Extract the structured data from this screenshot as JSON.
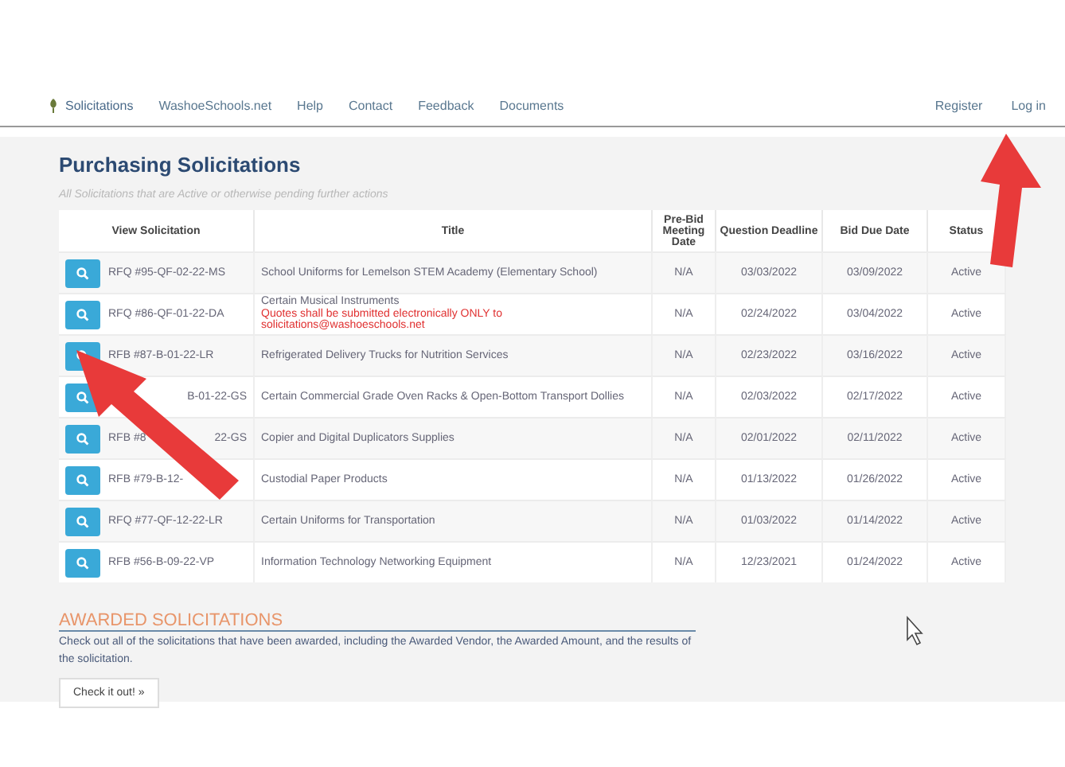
{
  "nav": {
    "items": [
      {
        "label": "Solicitations",
        "selected": true
      },
      {
        "label": "WashoeSchools.net",
        "selected": false
      },
      {
        "label": "Help",
        "selected": false
      },
      {
        "label": "Contact",
        "selected": false
      },
      {
        "label": "Feedback",
        "selected": false
      },
      {
        "label": "Documents",
        "selected": false
      }
    ],
    "right": [
      "Register",
      "Log in"
    ]
  },
  "heading": "Purchasing Solicitations",
  "subheading": "All Solicitations that are Active or otherwise pending further actions",
  "table": {
    "columns": [
      "View Solicitation",
      "Title",
      "Pre-Bid Meeting Date",
      "Question Deadline",
      "Bid Due Date",
      "Status"
    ],
    "rows": [
      {
        "solicitation": "RFQ #95-QF-02-22-MS",
        "title": "School Uniforms for Lemelson STEM Academy (Elementary School)",
        "prebid": "N/A",
        "question": "03/03/2022",
        "due": "03/09/2022",
        "status": "Active"
      },
      {
        "solicitation": "RFQ #86-QF-01-22-DA",
        "title": "Certain Musical Instruments",
        "note": "Quotes shall be submitted electronically ONLY to solicitations@washoeschools.net",
        "prebid": "N/A",
        "question": "02/24/2022",
        "due": "03/04/2022",
        "status": "Active"
      },
      {
        "solicitation": "RFB #87-B-01-22-LR",
        "title": "Refrigerated Delivery Trucks for Nutrition Services",
        "prebid": "N/A",
        "question": "02/23/2022",
        "due": "03/16/2022",
        "status": "Active"
      },
      {
        "solicitation_end": "B-01-22-GS",
        "title": "Certain Commercial Grade Oven Racks & Open-Bottom Transport Dollies",
        "prebid": "N/A",
        "question": "02/03/2022",
        "due": "02/17/2022",
        "status": "Active"
      },
      {
        "solicitation": "RFB #8",
        "solicitation_end": "22-GS",
        "title": "Copier and Digital Duplicators Supplies",
        "prebid": "N/A",
        "question": "02/01/2022",
        "due": "02/11/2022",
        "status": "Active"
      },
      {
        "solicitation": "RFB #79-B-12-",
        "title": "Custodial Paper Products",
        "prebid": "N/A",
        "question": "01/13/2022",
        "due": "01/26/2022",
        "status": "Active"
      },
      {
        "solicitation": "RFQ #77-QF-12-22-LR",
        "title": "Certain Uniforms for Transportation",
        "prebid": "N/A",
        "question": "01/03/2022",
        "due": "01/14/2022",
        "status": "Active"
      },
      {
        "solicitation": "RFB #56-B-09-22-VP",
        "title": "Information Technology Networking Equipment",
        "prebid": "N/A",
        "question": "12/23/2021",
        "due": "01/24/2022",
        "status": "Active"
      }
    ]
  },
  "awarded": {
    "heading": "AWARDED SOLICITATIONS",
    "text": "Check out all of the solicitations that have been awarded, including the Awarded Vendor, the Awarded Amount, and the results of the solicitation.",
    "button": "Check it out! »"
  }
}
